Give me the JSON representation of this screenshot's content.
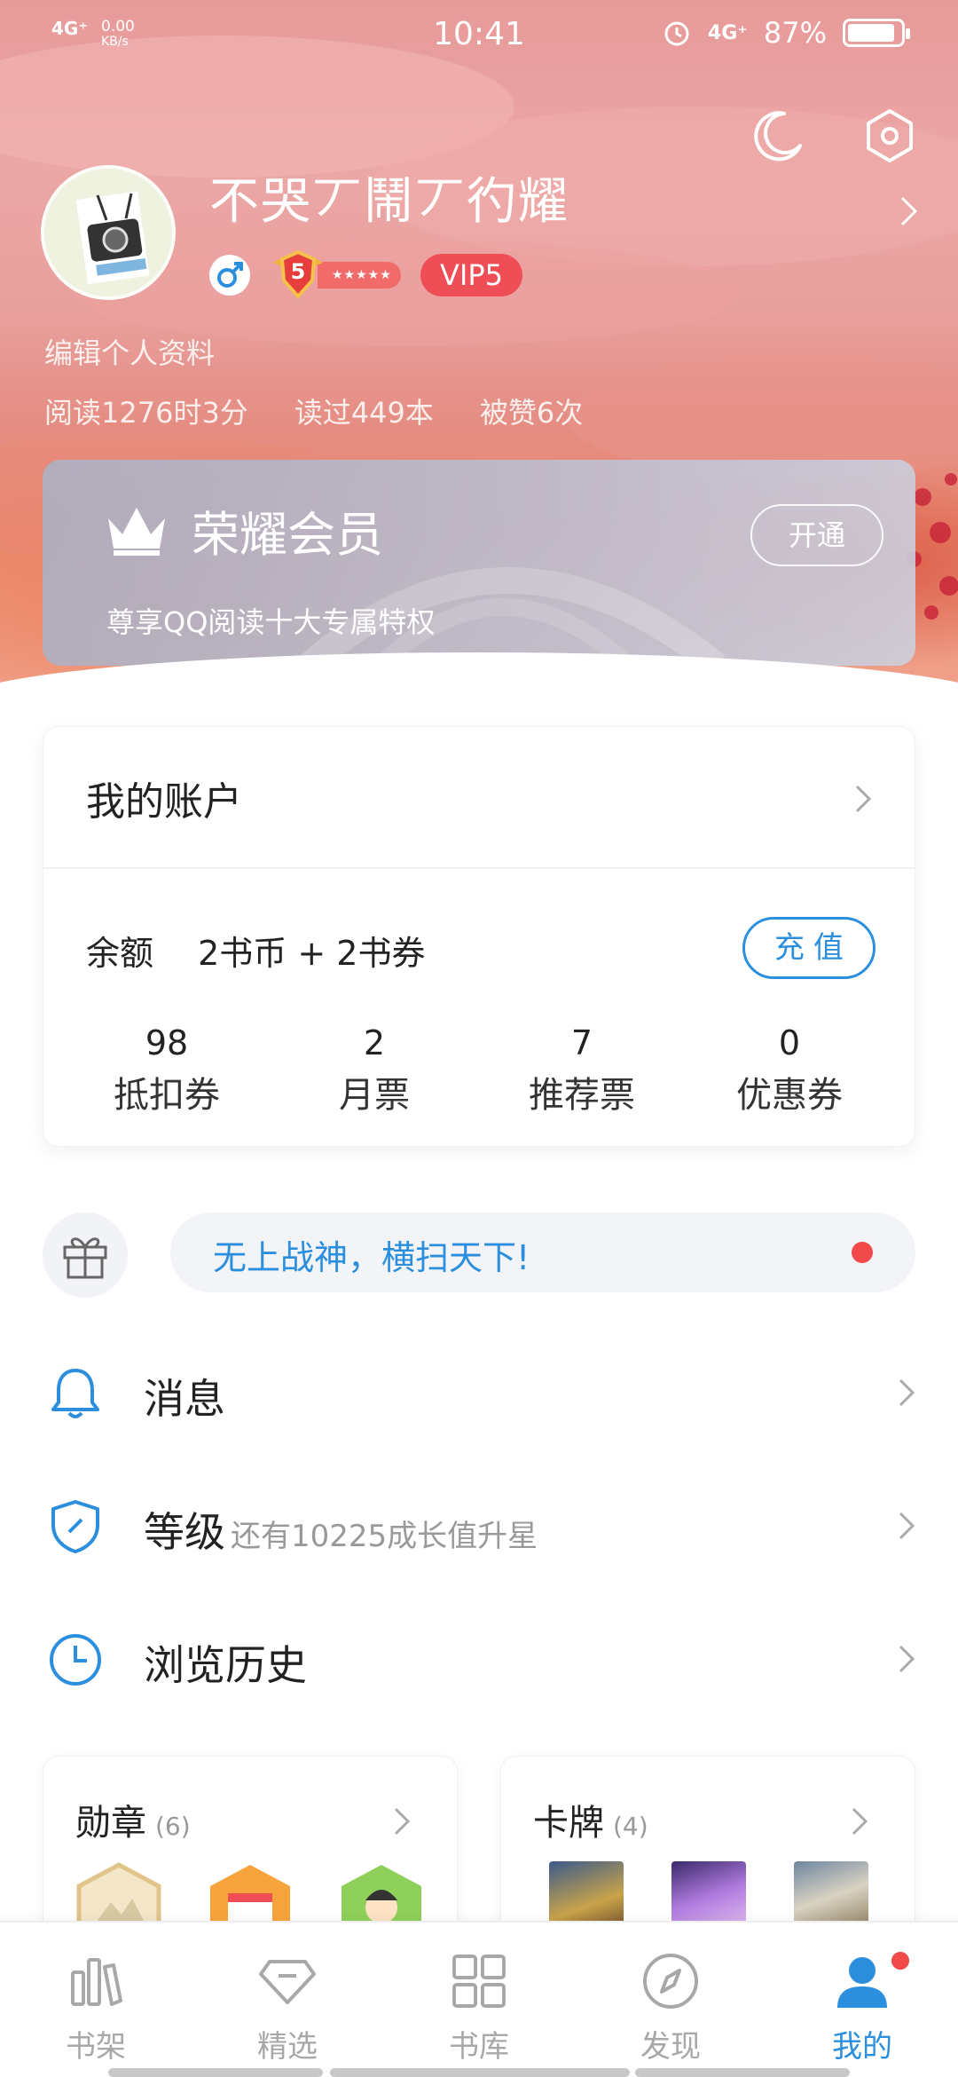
{
  "status_bar": {
    "signal": "4G⁺",
    "speed": "0.00",
    "speed_unit": "KB/s",
    "time": "10:41",
    "network_right": "4G⁺",
    "battery": "87%"
  },
  "profile": {
    "username": "不哭丆鬧丆彴耀",
    "level": "5",
    "vip": "VIP5",
    "edit_link": "编辑个人资料",
    "stats": [
      "阅读1276时3分",
      "读过449本",
      "被赞6次"
    ]
  },
  "vip_card": {
    "title": "荣耀会员",
    "subtitle": "尊享QQ阅读十大专属特权",
    "button": "开通"
  },
  "account": {
    "title": "我的账户",
    "balance_label": "余额",
    "balance_value": "2书币 + 2书券",
    "recharge": "充值",
    "items": [
      {
        "value": "98",
        "label": "抵扣券"
      },
      {
        "value": "2",
        "label": "月票"
      },
      {
        "value": "7",
        "label": "推荐票"
      },
      {
        "value": "0",
        "label": "优惠券"
      }
    ]
  },
  "promo": {
    "text": "无上战神，横扫天下!"
  },
  "menu": {
    "messages": "消息",
    "level": "等级",
    "level_hint": "还有10225成长值升星",
    "history": "浏览历史"
  },
  "medals": {
    "title": "勋章",
    "count": "(6)"
  },
  "cards": {
    "title": "卡牌",
    "count": "(4)"
  },
  "tabs": [
    "书架",
    "精选",
    "书库",
    "发现",
    "我的"
  ],
  "colors": {
    "accent": "#2c8fde",
    "vip": "#ef4e57",
    "dot": "#f04a4a"
  }
}
